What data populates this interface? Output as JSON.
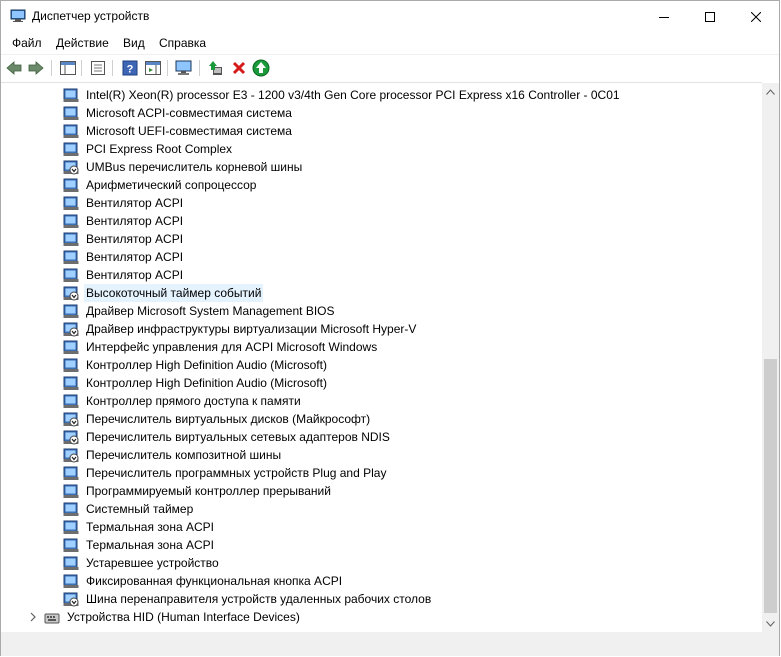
{
  "window": {
    "title": "Диспетчер устройств"
  },
  "menu": [
    "Файл",
    "Действие",
    "Вид",
    "Справка"
  ],
  "tree_items": [
    {
      "label": "Intel(R) Xeon(R) processor E3 - 1200 v3/4th Gen Core processor PCI Express x16 Controller - 0C01",
      "icon": "system-device-icon"
    },
    {
      "label": "Microsoft ACPI-совместимая система",
      "icon": "system-device-icon"
    },
    {
      "label": "Microsoft UEFI-совместимая система",
      "icon": "system-device-icon"
    },
    {
      "label": "PCI Express Root Complex",
      "icon": "system-device-icon"
    },
    {
      "label": "UMBus перечислитель корневой шины",
      "icon": "system-device-warn-icon"
    },
    {
      "label": "Арифметический сопроцессор",
      "icon": "system-device-icon"
    },
    {
      "label": "Вентилятор ACPI",
      "icon": "system-device-icon"
    },
    {
      "label": "Вентилятор ACPI",
      "icon": "system-device-icon"
    },
    {
      "label": "Вентилятор ACPI",
      "icon": "system-device-icon"
    },
    {
      "label": "Вентилятор ACPI",
      "icon": "system-device-icon"
    },
    {
      "label": "Вентилятор ACPI",
      "icon": "system-device-icon"
    },
    {
      "label": "Высокоточный таймер событий",
      "icon": "system-device-warn-icon",
      "selected": true
    },
    {
      "label": "Драйвер Microsoft System Management BIOS",
      "icon": "system-device-icon"
    },
    {
      "label": "Драйвер инфраструктуры виртуализации Microsoft Hyper-V",
      "icon": "system-device-warn-icon"
    },
    {
      "label": "Интерфейс управления для ACPI Microsoft Windows",
      "icon": "system-device-icon"
    },
    {
      "label": "Контроллер High Definition Audio (Microsoft)",
      "icon": "system-device-icon"
    },
    {
      "label": "Контроллер High Definition Audio (Microsoft)",
      "icon": "system-device-icon"
    },
    {
      "label": "Контроллер прямого доступа к памяти",
      "icon": "system-device-icon"
    },
    {
      "label": "Перечислитель виртуальных дисков (Майкрософт)",
      "icon": "system-device-warn-icon"
    },
    {
      "label": "Перечислитель виртуальных сетевых адаптеров NDIS",
      "icon": "system-device-warn-icon"
    },
    {
      "label": "Перечислитель композитной шины",
      "icon": "system-device-warn-icon"
    },
    {
      "label": "Перечислитель программных устройств Plug and Play",
      "icon": "system-device-icon"
    },
    {
      "label": "Программируемый контроллер прерываний",
      "icon": "system-device-icon"
    },
    {
      "label": "Системный таймер",
      "icon": "system-device-icon"
    },
    {
      "label": "Термальная зона ACPI",
      "icon": "system-device-icon"
    },
    {
      "label": "Термальная зона ACPI",
      "icon": "system-device-icon"
    },
    {
      "label": "Устаревшее устройство",
      "icon": "system-device-icon"
    },
    {
      "label": "Фиксированная функциональная кнопка ACPI",
      "icon": "system-device-icon"
    },
    {
      "label": "Шина перенаправителя устройств удаленных рабочих столов",
      "icon": "system-device-warn-icon"
    }
  ],
  "hid_category": {
    "label": "Устройства HID (Human Interface Devices)",
    "icon": "hid-device-icon"
  },
  "colors": {
    "accent": "#e5f3ff",
    "window_border": "#aaaaaa",
    "scrollbar": "#f0f0f0",
    "thumb": "#cdcdcd"
  }
}
